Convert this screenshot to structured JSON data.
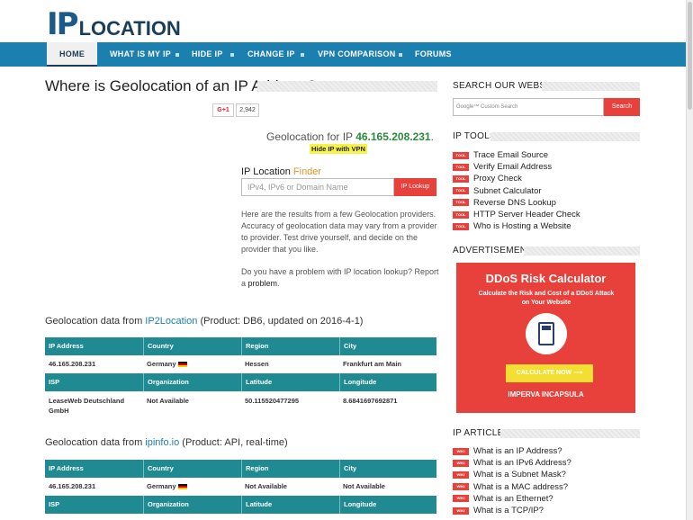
{
  "logo": {
    "ip": "IP",
    "location": "LOCATION"
  },
  "nav": {
    "items": [
      "HOME",
      "WHAT IS MY IP",
      "HIDE IP",
      "CHANGE IP",
      "VPN COMPARISON",
      "FORUMS"
    ]
  },
  "page": {
    "title": "Where is Geolocation of an IP Address?",
    "gplus_label": "G+1",
    "gplus_count": "2,942",
    "geo_for_prefix": "Geolocation for IP",
    "ip": "46.165.208.231",
    "geo_for_suffix": ".",
    "hide_link": "Hide IP with VPN"
  },
  "lookup": {
    "label_prefix": "IP Location",
    "label_finder": "Finder",
    "placeholder": "IPv4, IPv6 or Domain Name",
    "button": "IP Lookup"
  },
  "intro": "Here are the results from a few Geolocation providers. Accuracy of geolocation data may vary from a provider to provider. Test drive yourself, and decide on the provider that you like.",
  "report": {
    "text": "Do you have a problem with IP location lookup? Report a",
    "link": "problem",
    "suffix": "."
  },
  "section1": {
    "prefix": "Geolocation data from",
    "provider": "IP2Location",
    "suffix": "(Product: DB6, updated on 2016-4-1)",
    "headers1": [
      "IP Address",
      "Country",
      "Region",
      "City"
    ],
    "values1": [
      "46.165.208.231",
      "Germany",
      "Hessen",
      "Frankfurt am Main"
    ],
    "headers2": [
      "ISP",
      "Organization",
      "Latitude",
      "Longitude"
    ],
    "values2": [
      "LeaseWeb Deutschland GmbH",
      "Not Available",
      "50.115520477295",
      "8.6841697692871"
    ]
  },
  "section2": {
    "prefix": "Geolocation data from",
    "provider": "ipinfo.io",
    "suffix": "(Product: API, real-time)",
    "headers1": [
      "IP Address",
      "Country",
      "Region",
      "City"
    ],
    "values1": [
      "46.165.208.231",
      "Germany",
      "Not Available",
      "Not Available"
    ],
    "headers2": [
      "ISP",
      "Organization",
      "Latitude",
      "Longitude"
    ]
  },
  "sidebar": {
    "search_heading": "SEARCH OUR WEBSITE",
    "search_placeholder": "Google™ Custom Search",
    "search_button": "Search",
    "tools_heading": "IP TOOLS",
    "tool_badge": "TOOL",
    "tools": [
      "Trace Email Source",
      "Verify Email Address",
      "Proxy Check",
      "Subnet Calculator",
      "Reverse DNS Lookup",
      "HTTP Server Header Check",
      "Who is Hosting a Website"
    ],
    "ad_heading": "ADVERTISEMENT",
    "ad": {
      "title": "DDoS Risk Calculator",
      "subtitle": "Calculate the Risk and Cost of a DDoS Attack on Your Website",
      "cta": "CALCULATE NOW",
      "brand": "IMPERVA INCAPSULA"
    },
    "articles_heading": "IP ARTICLES",
    "article_badge": "WIKI",
    "articles": [
      "What is an IP Address?",
      "What is an IPv6 Address?",
      "What is a Subnet Mask?",
      "What is a MAC address?",
      "What is an Ethernet?",
      "What is a TCP/IP?"
    ]
  },
  "colors": {
    "nav": "#1b7fb0",
    "table_header": "#1f8a92",
    "accent": "#e8403a",
    "ip_green": "#2a8a3e"
  }
}
